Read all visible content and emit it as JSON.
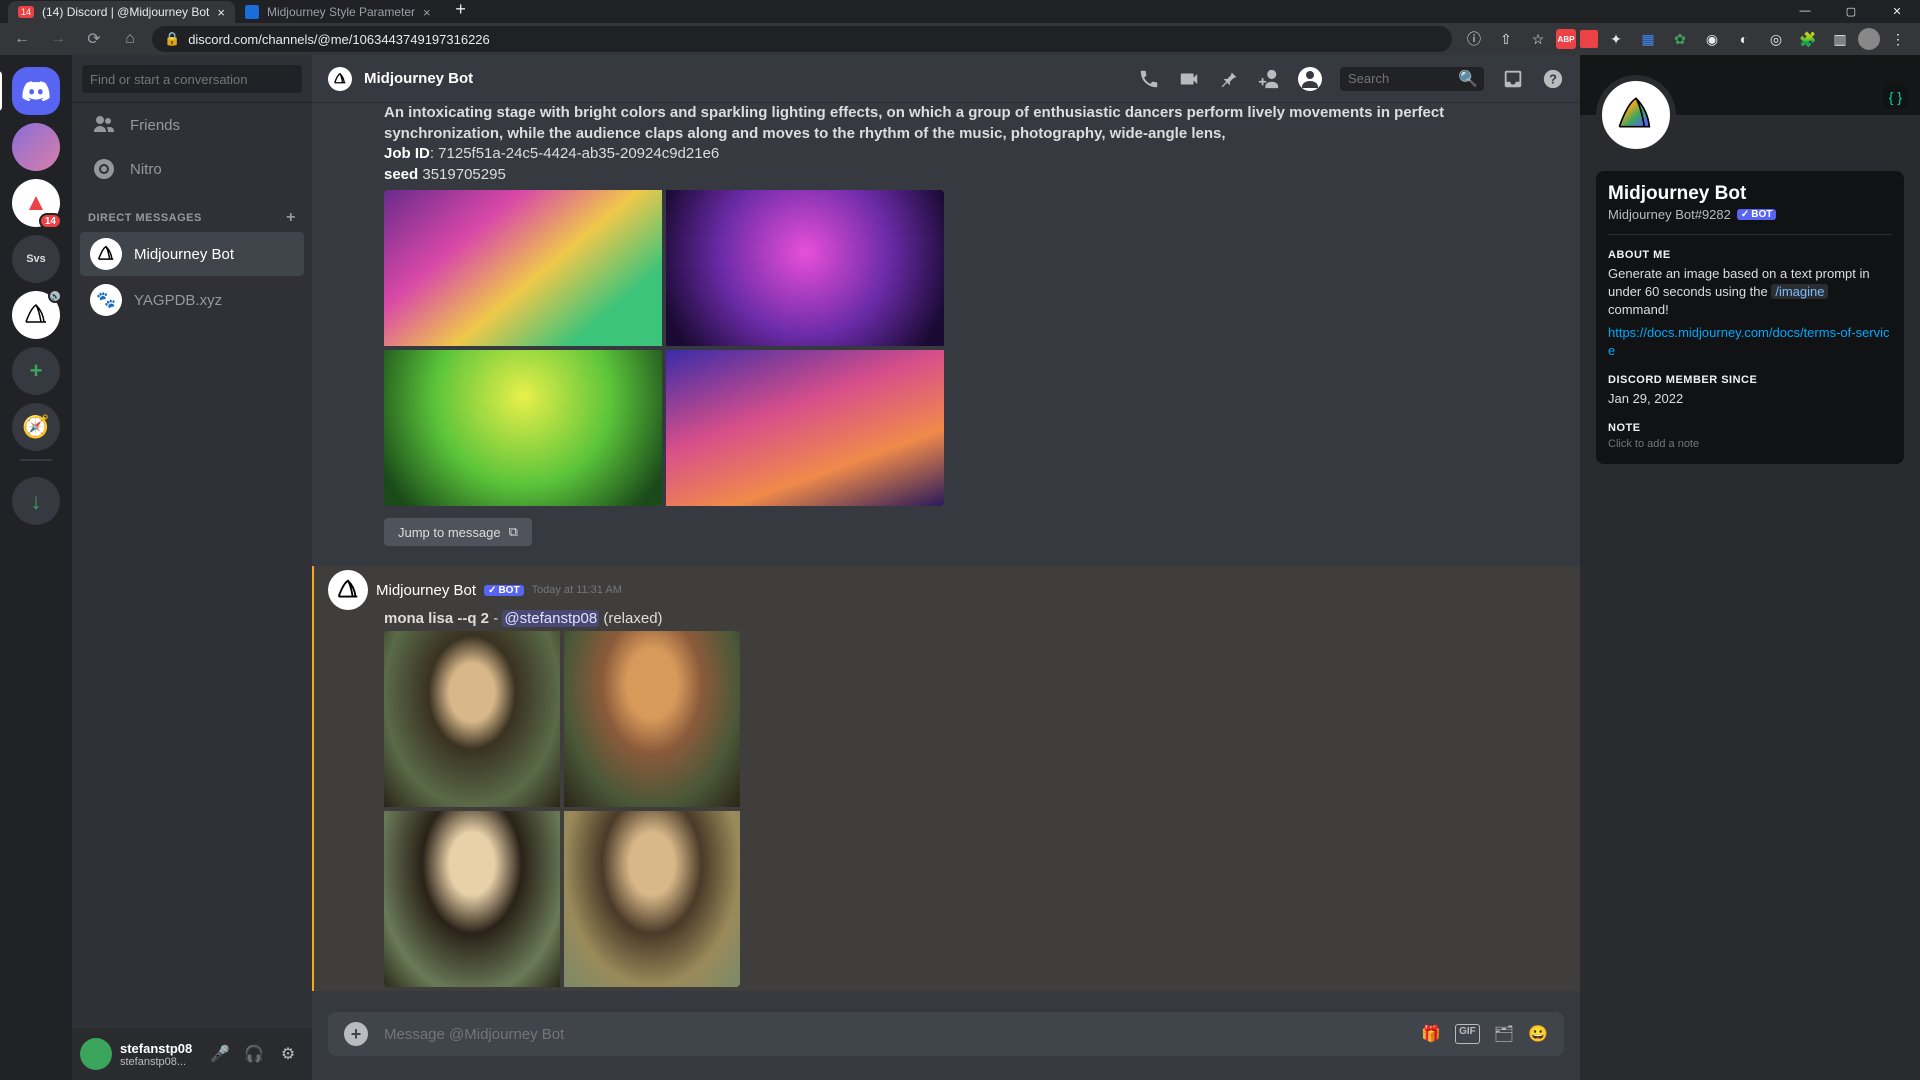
{
  "browser": {
    "tabs": [
      {
        "title": "(14) Discord | @Midjourney Bot",
        "active": true,
        "favicon_badge": "14"
      },
      {
        "title": "Midjourney Style Parameter",
        "active": false
      }
    ],
    "url": "discord.com/channels/@me/1063443749197316226",
    "toolbar_icons": [
      "translate-icon",
      "share-icon",
      "star-icon",
      "abp-icon",
      "ext1-icon",
      "ext2-icon",
      "ext3-icon",
      "ext4-icon",
      "ext5-icon",
      "ext6-icon",
      "ext7-icon",
      "ext8-icon",
      "puzzle-icon",
      "panel-icon",
      "avatar-icon",
      "menu-icon"
    ]
  },
  "guilds": {
    "items": [
      {
        "type": "home",
        "badge": null
      },
      {
        "type": "avatar",
        "label": "",
        "badge": null
      },
      {
        "type": "server",
        "label": "",
        "badge": "14",
        "color": "#ed4245"
      },
      {
        "type": "text",
        "label": "Svs",
        "badge": null
      },
      {
        "type": "server",
        "label": "",
        "badge": null,
        "voice": true
      }
    ]
  },
  "sidebar": {
    "search_placeholder": "Find or start a conversation",
    "friends_label": "Friends",
    "nitro_label": "Nitro",
    "dm_header": "DIRECT MESSAGES",
    "dms": [
      {
        "name": "Midjourney Bot",
        "active": true
      },
      {
        "name": "YAGPDB.xyz",
        "active": false
      }
    ]
  },
  "user_panel": {
    "name": "stefanstp08",
    "tag": "stefanstp08..."
  },
  "chat": {
    "title": "Midjourney Bot",
    "search_placeholder": "Search",
    "msg1": {
      "line1": "An intoxicating stage with bright colors and sparkling lighting effects, on which a group of enthusiastic dancers perform lively movements in perfect synchronization, while the audience claps along and moves to the rhythm of the music, photography, wide-angle lens,",
      "jobid_label": "Job ID",
      "jobid_value": ": 7125f51a-24c5-4424-ab35-20924c9d21e6",
      "seed_label": "seed",
      "seed_value": " 3519705295",
      "jump_label": "Jump to message"
    },
    "msg2": {
      "author": "Midjourney Bot",
      "bot_tag": "BOT",
      "time": "Today at 11:31 AM",
      "prompt_bold": "mona lisa --q 2",
      "dash": " - ",
      "mention": "@stefanstp08",
      "suffix": " (relaxed)"
    },
    "input_placeholder": "Message @Midjourney Bot",
    "input_icons": {
      "gift": "🎁",
      "gif": "GIF",
      "sticker": "🗂",
      "emoji": "😀"
    }
  },
  "profile": {
    "name": "Midjourney Bot",
    "tag": "Midjourney Bot#9282",
    "bot_tag": "BOT",
    "about_header": "ABOUT ME",
    "about_body_pre": "Generate an image based on a text prompt in under 60 seconds using the ",
    "about_cmd": "/imagine",
    "about_body_post": " command!",
    "about_link": "https://docs.midjourney.com/docs/terms-of-service",
    "since_header": "DISCORD MEMBER SINCE",
    "since_value": "Jan 29, 2022",
    "note_header": "NOTE",
    "note_placeholder": "Click to add a note"
  }
}
